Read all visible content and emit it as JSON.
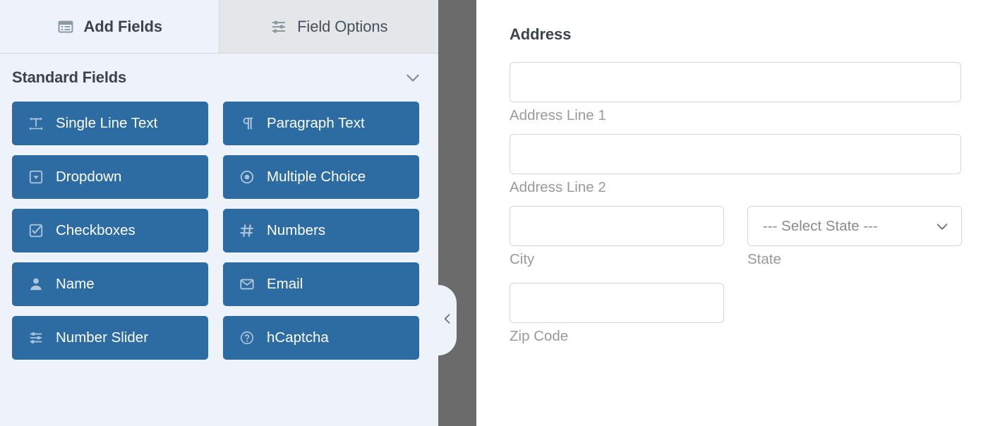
{
  "builder": {
    "tabs": [
      {
        "label": "Add Fields",
        "icon": "list-icon",
        "active": true
      },
      {
        "label": "Field Options",
        "icon": "sliders-icon",
        "active": false
      }
    ],
    "section": {
      "title": "Standard Fields",
      "toggle_icon": "chevron-down-icon"
    },
    "fields": [
      {
        "label": "Single Line Text",
        "icon": "text-width-icon"
      },
      {
        "label": "Paragraph Text",
        "icon": "paragraph-icon"
      },
      {
        "label": "Dropdown",
        "icon": "caret-square-down-icon"
      },
      {
        "label": "Multiple Choice",
        "icon": "radio-button-icon"
      },
      {
        "label": "Checkboxes",
        "icon": "check-square-icon"
      },
      {
        "label": "Numbers",
        "icon": "hashtag-icon"
      },
      {
        "label": "Name",
        "icon": "user-icon"
      },
      {
        "label": "Email",
        "icon": "envelope-icon"
      },
      {
        "label": "Number Slider",
        "icon": "sliders-icon"
      },
      {
        "label": "hCaptcha",
        "icon": "question-circle-icon"
      }
    ],
    "collapse_handle": {
      "icon": "chevron-left-icon"
    },
    "colors": {
      "field_button": "#2d6ca2",
      "panel_background": "#eef3f9",
      "divider": "#6b6b6b",
      "active_tab": "#eef3f9",
      "inactive_tab": "#e4e7ea"
    }
  },
  "preview": {
    "title": "Address",
    "rows": [
      {
        "type": "single",
        "fields": [
          {
            "kind": "text",
            "value": "",
            "sublabel": "Address Line 1"
          }
        ]
      },
      {
        "type": "single",
        "fields": [
          {
            "kind": "text",
            "value": "",
            "sublabel": "Address Line 2"
          }
        ]
      },
      {
        "type": "pair",
        "fields": [
          {
            "kind": "text",
            "value": "",
            "sublabel": "City"
          },
          {
            "kind": "select",
            "value": "--- Select State ---",
            "sublabel": "State",
            "icon": "chevron-down-icon"
          }
        ]
      },
      {
        "type": "single-half",
        "fields": [
          {
            "kind": "text",
            "value": "",
            "sublabel": "Zip Code"
          }
        ]
      }
    ]
  }
}
